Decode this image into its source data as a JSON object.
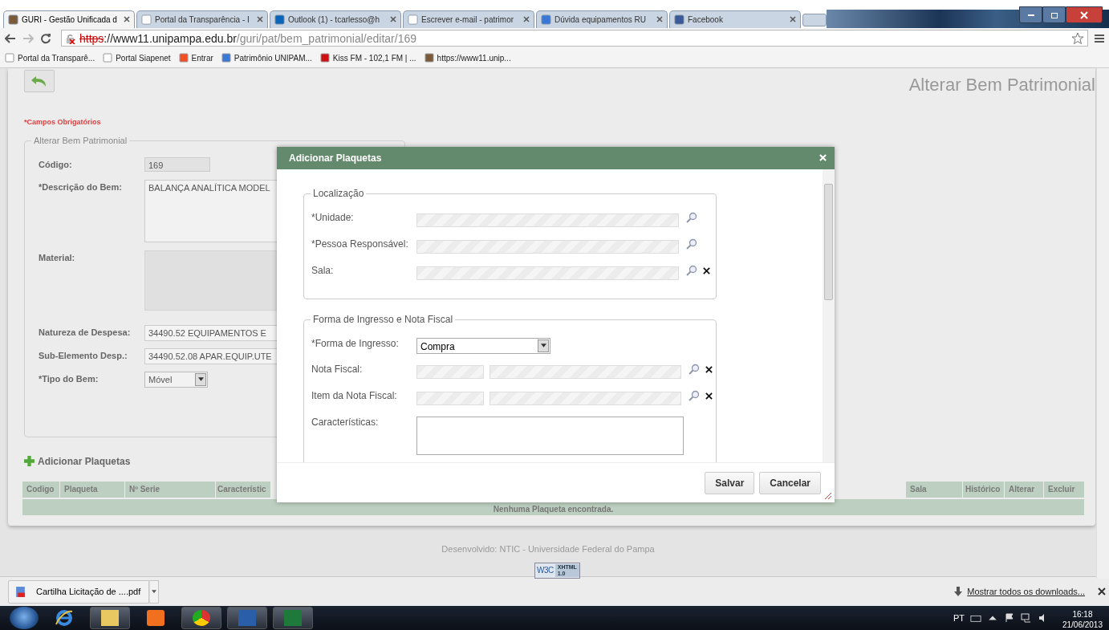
{
  "browser": {
    "tabs": [
      {
        "title": "GURI - Gestão Unificada d",
        "selected": true
      },
      {
        "title": "Portal da Transparência - I",
        "selected": false
      },
      {
        "title": "Outlook (1) - tcarlesso@h",
        "selected": false
      },
      {
        "title": "Escrever e-mail - patrimor",
        "selected": false
      },
      {
        "title": "Dúvida equipamentos RU",
        "selected": false
      },
      {
        "title": "Facebook",
        "selected": false
      }
    ],
    "address": {
      "scheme": "https",
      "host": "://www11.unipampa.edu.br",
      "path": "/guri/pat/bem_patrimonial/editar/169"
    },
    "bookmarks": [
      "Portal da Transparê...",
      "Portal Siapenet",
      "Entrar",
      "Patrimônio UNIPAM...",
      "Kiss FM - 102,1 FM | ...",
      "https://www11.unip..."
    ]
  },
  "page": {
    "title": "Alterar Bem Patrimonial",
    "required_note": "*Campos Obrigatórios",
    "form": {
      "legend": "Alterar Bem Patrimonial",
      "fields": [
        {
          "kind": "readonly",
          "label": "Código:",
          "value": "169"
        },
        {
          "kind": "textarea",
          "label": "*Descrição do Bem:",
          "value": "BALANÇA ANALÍTICA MODEL"
        },
        {
          "kind": "box",
          "label": "Material:"
        },
        {
          "kind": "text",
          "label": "Natureza de Despesa:",
          "value": "34490.52 EQUIPAMENTOS E"
        },
        {
          "kind": "text",
          "label": "Sub-Elemento Desp.:",
          "value": "34490.52.08 APAR.EQUIP.UTE"
        },
        {
          "kind": "select",
          "label": "*Tipo do Bem:",
          "value": "Móvel"
        }
      ]
    },
    "add_link": "Adicionar Plaquetas",
    "table": {
      "columns_left": [
        "Codigo",
        "Plaqueta",
        "Nº Serie",
        "Característic"
      ],
      "columns_right": [
        "Sala",
        "Histórico",
        "Alterar",
        "Excluir"
      ],
      "empty_message": "Nenhuma Plaqueta encontrada."
    },
    "footer": "Desenvolvido: NTIC - Universidade Federal do Pampa",
    "badge": {
      "brand": "W3C",
      "label": "XHTML",
      "version": "1.0"
    }
  },
  "dialog": {
    "title": "Adicionar Plaquetas",
    "sections": [
      {
        "legend": "Localização",
        "rows": [
          {
            "kind": "lookup",
            "label": "*Unidade:",
            "clearable": false
          },
          {
            "kind": "lookup",
            "label": "*Pessoa Responsável:",
            "clearable": false
          },
          {
            "kind": "lookup",
            "label": "Sala:",
            "clearable": true
          }
        ]
      },
      {
        "legend": "Forma de Ingresso e Nota Fiscal",
        "rows": [
          {
            "kind": "select",
            "label": "*Forma de Ingresso:",
            "value": "Compra"
          },
          {
            "kind": "lookup_pair",
            "label": "Nota Fiscal:",
            "clearable": true
          },
          {
            "kind": "lookup_pair",
            "label": "Item da Nota Fiscal:",
            "clearable": true
          },
          {
            "kind": "textarea",
            "label": "Características:"
          }
        ]
      }
    ],
    "buttons": [
      "Salvar",
      "Cancelar"
    ]
  },
  "downloads": {
    "file": "Cartilha Licitação de ....pdf",
    "show_all": "Mostrar todos os downloads..."
  },
  "taskbar": {
    "language": "PT",
    "time": "16:18",
    "date": "21/06/2013"
  }
}
